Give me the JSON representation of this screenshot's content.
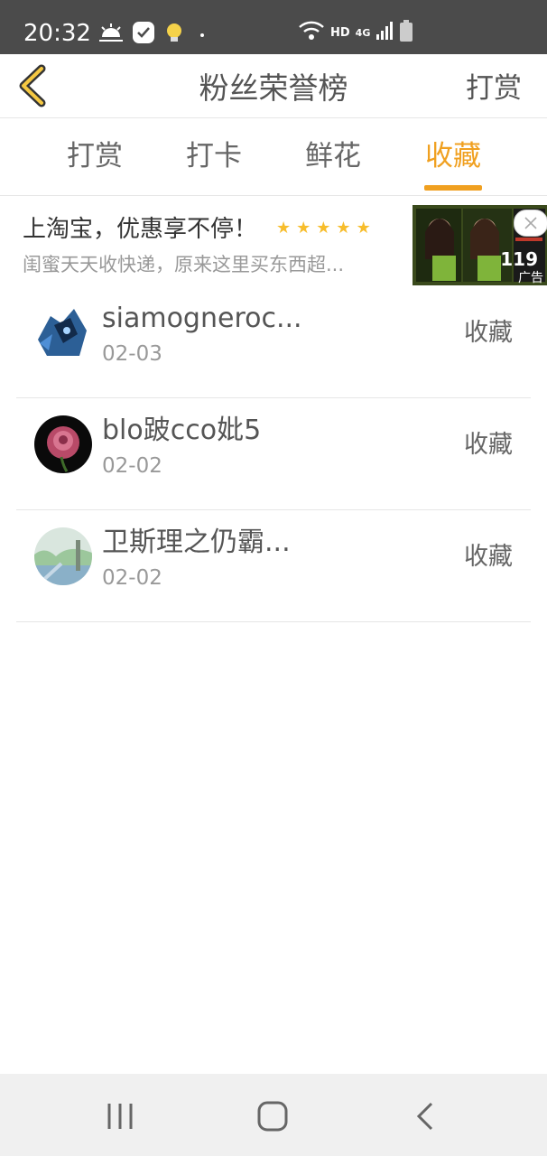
{
  "status_bar": {
    "time": "20:32",
    "icons": [
      "weather-icon",
      "app-badge-icon",
      "bulb-icon",
      "wifi-icon",
      "signal-icon",
      "battery-icon"
    ],
    "hd": "HD",
    "network": "4G"
  },
  "header": {
    "title": "粉丝荣誉榜",
    "right_action": "打赏"
  },
  "tabs": [
    {
      "label": "打赏",
      "active": false
    },
    {
      "label": "打卡",
      "active": false
    },
    {
      "label": "鲜花",
      "active": false
    },
    {
      "label": "收藏",
      "active": true
    }
  ],
  "ad": {
    "title": "上淘宝，优惠享不停！",
    "rating_stars": 5,
    "description": "闺蜜天天收快递，原来这里买东西超...",
    "price": "119",
    "label": "广告"
  },
  "fans": [
    {
      "name": "siamogneroc...",
      "date": "02-03",
      "action": "收藏"
    },
    {
      "name": "blo跛cco妣5",
      "date": "02-02",
      "action": "收藏"
    },
    {
      "name": "卫斯理之仍霸...",
      "date": "02-02",
      "action": "收藏"
    }
  ],
  "colors": {
    "accent": "#f0a020",
    "status_bar": "#4b4b4b",
    "star": "#f7bd2c"
  }
}
